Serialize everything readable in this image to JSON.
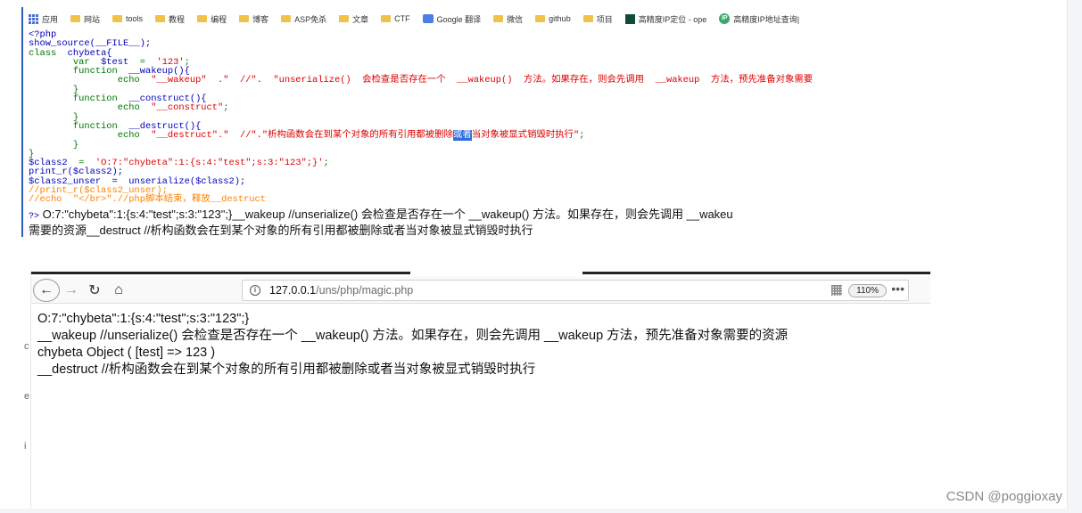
{
  "bookmarks": [
    {
      "label": "应用",
      "icon": "apps-icon"
    },
    {
      "label": "网站",
      "icon": "folder-icon"
    },
    {
      "label": "tools",
      "icon": "folder-icon"
    },
    {
      "label": "教程",
      "icon": "folder-icon"
    },
    {
      "label": "编程",
      "icon": "folder-icon"
    },
    {
      "label": "博客",
      "icon": "folder-icon"
    },
    {
      "label": "ASP免杀",
      "icon": "folder-icon"
    },
    {
      "label": "文章",
      "icon": "folder-icon"
    },
    {
      "label": "CTF",
      "icon": "folder-icon"
    },
    {
      "label": "Google 翻译",
      "icon": "translate-icon"
    },
    {
      "label": "微信",
      "icon": "folder-icon"
    },
    {
      "label": "github",
      "icon": "folder-icon"
    },
    {
      "label": "项目",
      "icon": "folder-icon"
    },
    {
      "label": "高精度IP定位 - ope",
      "icon": "geo-icon"
    },
    {
      "label": "高精度IP地址查询|",
      "icon": "ip-icon"
    }
  ],
  "code": {
    "l01": "<?php",
    "l02": "show_source(__FILE__);",
    "l03_kw": "class",
    "l03": "  chybeta{",
    "l04_kw": "        var",
    "l04_var": "  $test",
    "l04_op": "  =  ",
    "l04_str": "'123'",
    "l04_end": ";",
    "l05_kw": "        function",
    "l05": "  __wakeup(){",
    "l06_kw": "                echo",
    "l06_str": "  \"__wakeup\"  .\"  //\".  \"unserialize()  会检查是否存在一个  __wakeup()  方法。如果存在，则会先调用  __wakeup  方法，预先准备对象需要",
    "l07": "        }",
    "l08_kw": "        function",
    "l08": "  __construct(){",
    "l09_kw": "                echo",
    "l09_str": "  \"__construct\"",
    "l09_end": ";",
    "l10": "        }",
    "l11_kw": "        function",
    "l11": "  __destruct(){",
    "l12_kw": "                echo",
    "l12_str_a": "  \"__destruct\".\"  //\".\"析构函数会在到某个对象的所有引用都被删除",
    "l12_sel": "或者",
    "l12_str_b": "当对象被显式销毁时执行\"",
    "l12_end": ";",
    "l13": "        }",
    "l14": "}",
    "l15_var": "$class2",
    "l15_op": "  =  ",
    "l15_str": "'O:7:\"chybeta\":1:{s:4:\"test\";s:3:\"123\";}'",
    "l15_end": ";",
    "l16": "print_r($class2);",
    "l17_var": "$class2_unser",
    "l17": "  =  unserialize($class2);",
    "l18": "//print_r($class2_unser);",
    "l19": "//echo  \"</br>\".//php脚本结束，释放__destruct"
  },
  "php_output": {
    "tag": "?>",
    "line1": " O:7:\"chybeta\":1:{s:4:\"test\";s:3:\"123\";}__wakeup //unserialize() 会检查是否存在一个 __wakeup() 方法。如果存在，则会先调用 __wakeu",
    "line2": "需要的资源__destruct //析构函数会在到某个对象的所有引用都被删除或者当对象被显式销毁时执行"
  },
  "browser": {
    "back_glyph": "←",
    "forward_glyph": "→",
    "reload_glyph": "↻",
    "home_glyph": "⌂",
    "info_glyph": "i",
    "url_host": "127.0.0.1",
    "url_path": "/uns/php/magic.php",
    "zoom": "110%",
    "more_glyph": "•••"
  },
  "page_output": {
    "line1": "O:7:\"chybeta\":1:{s:4:\"test\";s:3:\"123\";}",
    "line2": "__wakeup //unserialize() 会检查是否存在一个 __wakeup() 方法。如果存在，则会先调用 __wakeup 方法，预先准备对象需要的资源",
    "line3": "chybeta Object ( [test] => 123 )",
    "line4": "__destruct //析构函数会在到某个对象的所有引用都被删除或者当对象被显式销毁时执行"
  },
  "edge_chars": [
    "c",
    "e",
    "i"
  ],
  "watermark": "CSDN @poggioxay"
}
